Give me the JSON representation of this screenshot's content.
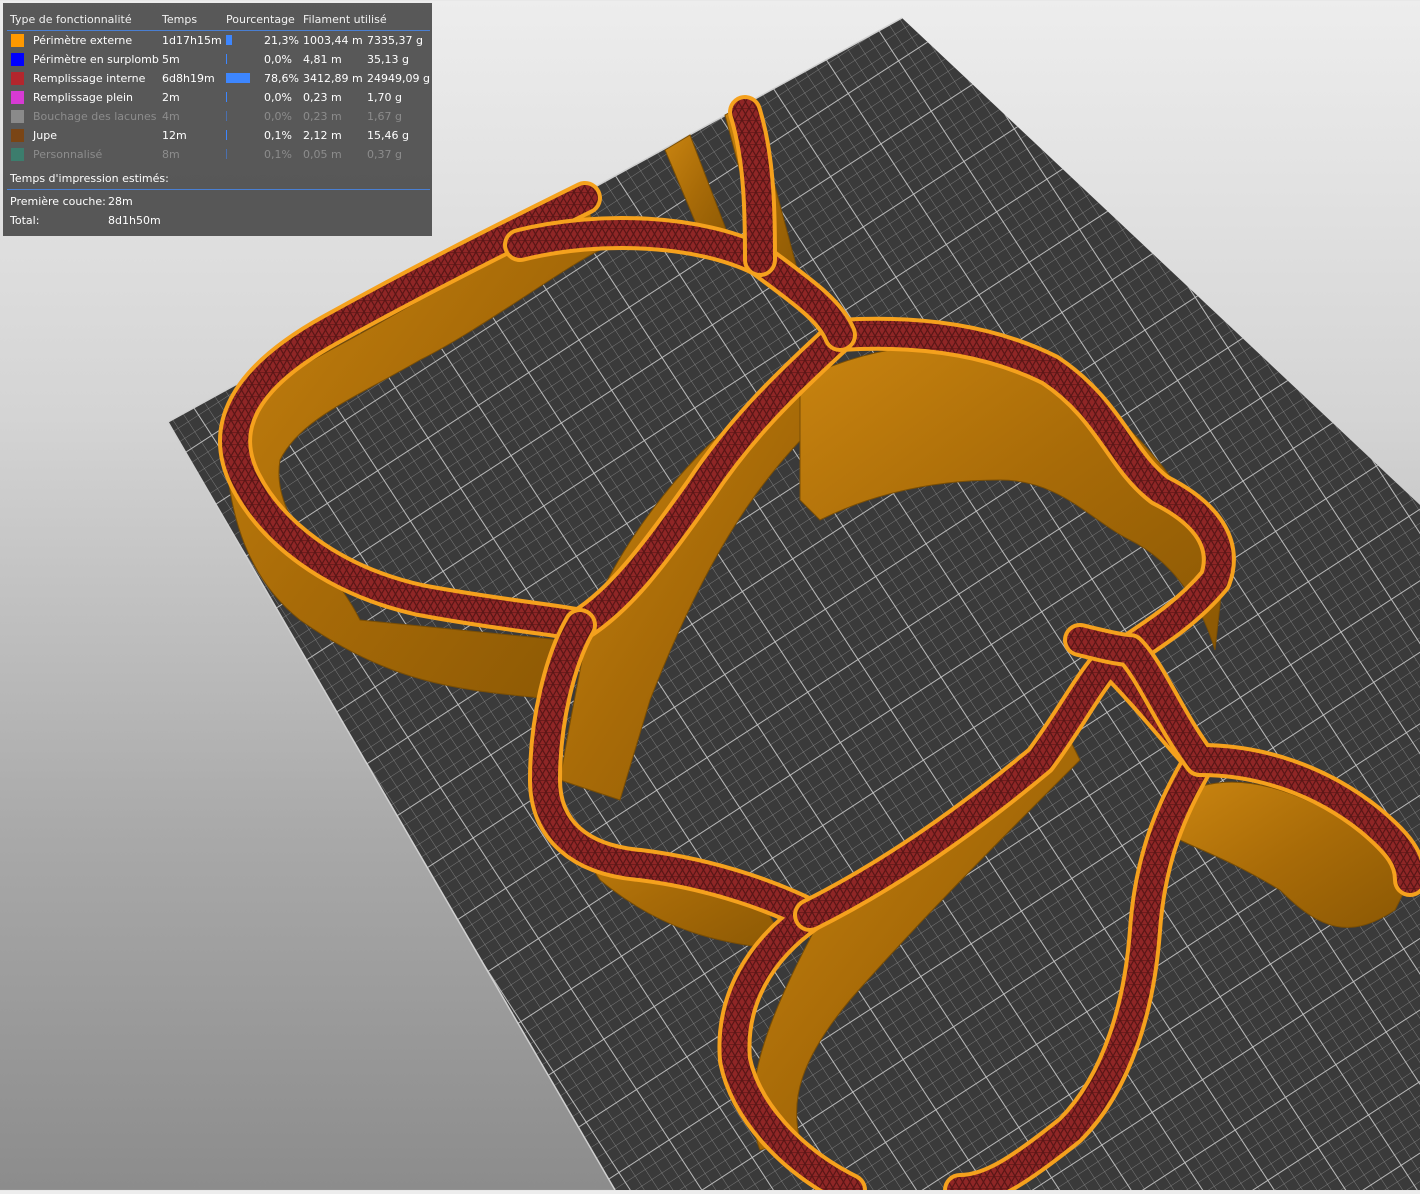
{
  "legend": {
    "headers": {
      "feature": "Type de fonctionnalité",
      "time": "Temps",
      "percentage": "Pourcentage",
      "filament": "Filament utilisé"
    },
    "rows": [
      {
        "name": "Périmètre externe",
        "time": "1d17h15m",
        "percent": "21,3%",
        "length": "1003,44 m",
        "weight": "7335,37 g",
        "color": "#ff9900",
        "fraction": 0.213,
        "dim": false
      },
      {
        "name": "Périmètre en surplomb",
        "time": "5m",
        "percent": "0,0%",
        "length": "4,81 m",
        "weight": "35,13 g",
        "color": "#0000ff",
        "fraction": 0.0,
        "dim": false
      },
      {
        "name": "Remplissage interne",
        "time": "6d8h19m",
        "percent": "78,6%",
        "length": "3412,89 m",
        "weight": "24949,09 g",
        "color": "#b3262d",
        "fraction": 0.786,
        "dim": false
      },
      {
        "name": "Remplissage plein",
        "time": "2m",
        "percent": "0,0%",
        "length": "0,23 m",
        "weight": "1,70 g",
        "color": "#d73ad3",
        "fraction": 0.0,
        "dim": false
      },
      {
        "name": "Bouchage des lacunes",
        "time": "4m",
        "percent": "0,0%",
        "length": "0,23 m",
        "weight": "1,67 g",
        "color": "#8a8a8a",
        "fraction": 0.0,
        "dim": true
      },
      {
        "name": "Jupe",
        "time": "12m",
        "percent": "0,1%",
        "length": "2,12 m",
        "weight": "15,46 g",
        "color": "#7a4515",
        "fraction": 0.001,
        "dim": false
      },
      {
        "name": "Personnalisé",
        "time": "8m",
        "percent": "0,1%",
        "length": "0,05 m",
        "weight": "0,37 g",
        "color": "#3c7d6d",
        "fraction": 0.001,
        "dim": true
      }
    ],
    "estimated_title": "Temps d'impression estimés:",
    "first_layer_label": "Première couche:",
    "first_layer_value": "28m",
    "total_label": "Total:",
    "total_value": "8d1h50m"
  },
  "colors": {
    "background_top": "#ededed",
    "background_bottom": "#8c8c8c",
    "bed": "#3b3b3b",
    "bed_grid": "#9a9a9a",
    "wall": "#b8740a",
    "perimeter": "#f5a11d",
    "infill": "#8f2424",
    "progress": "#3d86ff"
  },
  "icons": [
    "print-bed",
    "part-preview"
  ]
}
